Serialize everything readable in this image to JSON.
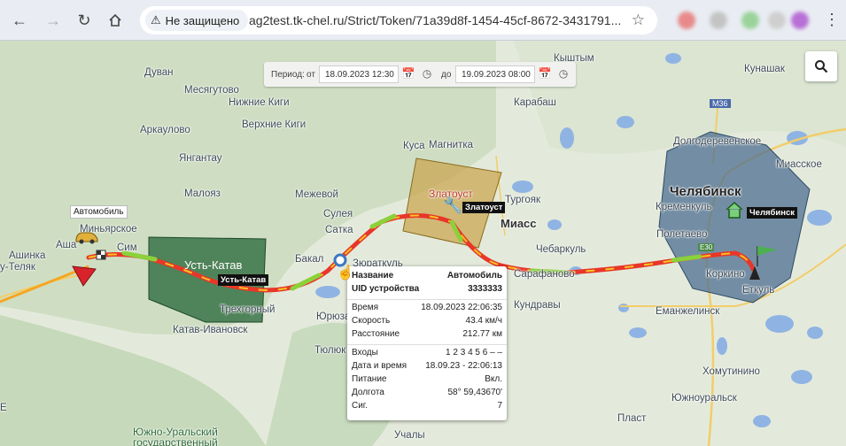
{
  "browser": {
    "back_icon": "arrow-left-icon",
    "security_text": "Не защищено",
    "url": "ag2test.tk-chel.ru/Strict/Token/71a39d8f-1454-45cf-8672-3431791..."
  },
  "period": {
    "label": "Период:",
    "from_label": "от",
    "from_value": "18.09.2023 12:30",
    "to_label": "до",
    "to_value": "19.09.2023 08:00"
  },
  "map_labels": {
    "duvan": "Дуван",
    "mesyagutovo": "Месягутово",
    "nizhnie_kigi": "Нижние Киги",
    "verkhnie_kigi": "Верхние Киги",
    "arkaulovo": "Аркаулово",
    "yangantau": "Янгантау",
    "maloyaz": "Малояз",
    "mezhevoy": "Межевой",
    "sulea": "Сулея",
    "satka": "Сатка",
    "bakal": "Бакал",
    "yuryuzan": "Юрюзань",
    "zyuratkul": "Зюраткуль",
    "ust_katav": "Усть-Катав",
    "trekhgorny": "Трехгорный",
    "katav_ivanovsk": "Катав-Ивановск",
    "tyulyuk": "Тюлюк",
    "ashinka": "Ашинка",
    "asha": "Аша",
    "kusa": "Куса",
    "magnitka": "Магнитка",
    "zlatoust": "Златоуст",
    "turgoyak": "Тургояк",
    "miass": "Миасс",
    "karabash": "Карабаш",
    "kyshtym": "Кыштым",
    "chebarkul": "Чебаркуль",
    "sarafanovo": "Сарафаново",
    "kundravy": "Кундравы",
    "chelyabinsk": "Челябинск",
    "kremenkul": "Кременкуль",
    "poletaevo": "Полетаево",
    "korkino": "Коркино",
    "etkul": "Еткуль",
    "emanzhelinsk": "Еманжелинск",
    "dolgoderevenskoe": "Долгодеревенское",
    "miasskoe": "Миасское",
    "kunashak": "Кунашак",
    "khomutinino": "Хомутинино",
    "yuzhnouralsk": "Южноуральск",
    "plast": "Пласт",
    "uchaly": "Учалы",
    "sim": "Сим",
    "yuzhno_uralsky": "Южно-Уральский государственный",
    "minyarskoe": "Миньярское",
    "teljak": "у-Теляк",
    "m36": "M36",
    "e30": "E30",
    "ye": "Е"
  },
  "tags": {
    "vehicle": "Автомобиль",
    "ust_katav": "Усть-Катав",
    "zlatoust": "Златоуст",
    "chelyabinsk": "Челябинск"
  },
  "popup": {
    "rows": [
      {
        "k": "Название",
        "v": "Автомобиль"
      },
      {
        "k": "UID устройства",
        "v": "3333333"
      },
      {
        "k": "Время",
        "v": "18.09.2023 22:06:35"
      },
      {
        "k": "Скорость",
        "v": "43.4 км/ч"
      },
      {
        "k": "Расстояние",
        "v": "212.77 км"
      },
      {
        "k": "Входы",
        "v": "1 2 3 4 5 6 – –"
      },
      {
        "k": "Дата и время",
        "v": "18.09.23 - 22:06:13"
      },
      {
        "k": "Питание",
        "v": "Вкл."
      },
      {
        "k": "Долгота",
        "v": "58° 59,43670'"
      },
      {
        "k": "Сиг.",
        "v": "7"
      }
    ]
  },
  "colors": {
    "geofence_green": "#2e6b3f",
    "geofence_yellow": "#c9a24a",
    "geofence_blue": "#4d6f91",
    "track_red": "#e8362a",
    "track_yellow": "#f5c51f",
    "track_green": "#8bd13a"
  }
}
